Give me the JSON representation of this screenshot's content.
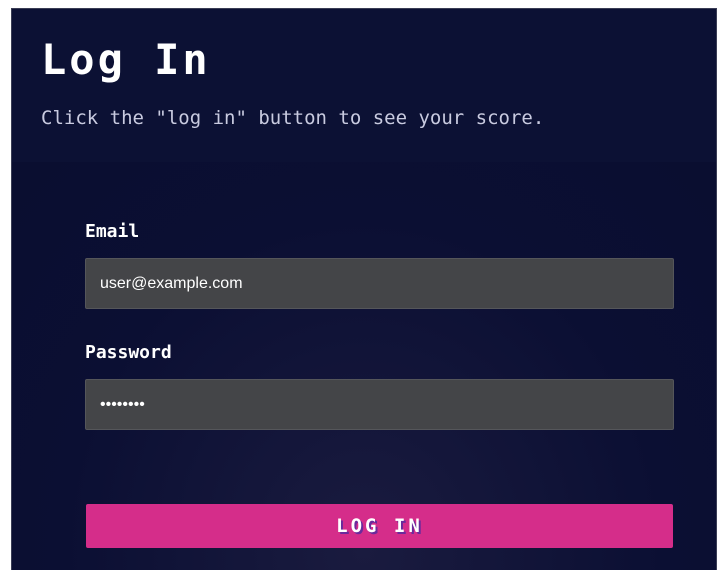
{
  "header": {
    "title": "Log In",
    "subtitle": "Click the \"log in\" button to see your score."
  },
  "form": {
    "email": {
      "label": "Email",
      "value": "user@example.com"
    },
    "password": {
      "label": "Password",
      "value": "password"
    },
    "submit_label": "LOG IN"
  },
  "colors": {
    "background": "#0b0f33",
    "input_background": "#444548",
    "button": "#d52d8a",
    "button_text_shadow": "#6a2a9c"
  }
}
